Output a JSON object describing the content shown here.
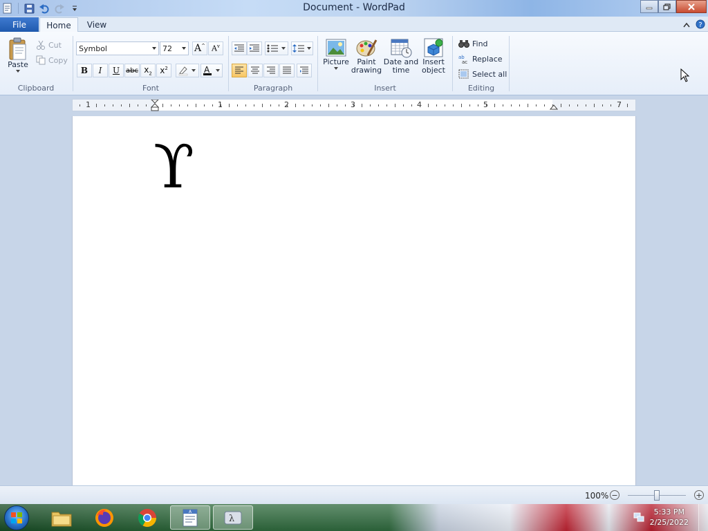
{
  "window": {
    "title": "Document - WordPad"
  },
  "tabs": {
    "file": "File",
    "home": "Home",
    "view": "View"
  },
  "ribbon": {
    "clipboard": {
      "label": "Clipboard",
      "paste": "Paste",
      "cut": "Cut",
      "copy": "Copy"
    },
    "font": {
      "label": "Font",
      "family": "Symbol",
      "size": "72"
    },
    "paragraph": {
      "label": "Paragraph"
    },
    "insert": {
      "label": "Insert",
      "picture": "Picture",
      "paint_line1": "Paint",
      "paint_line2": "drawing",
      "date_line1": "Date and",
      "date_line2": "time",
      "object_line1": "Insert",
      "object_line2": "object"
    },
    "editing": {
      "label": "Editing",
      "find": "Find",
      "replace": "Replace",
      "select_all": "Select all"
    }
  },
  "ruler": {
    "numbers": [
      "1",
      "1",
      "2",
      "3",
      "4",
      "5",
      "7"
    ]
  },
  "document": {
    "content": "ϒ"
  },
  "statusbar": {
    "zoom": "100%",
    "zoom_out": "−",
    "zoom_in": "+"
  },
  "taskbar": {
    "time": "5:33 PM",
    "date": "2/25/2022"
  },
  "colors": {
    "accent": "#1f5aae",
    "active_button": "#f8c765"
  }
}
